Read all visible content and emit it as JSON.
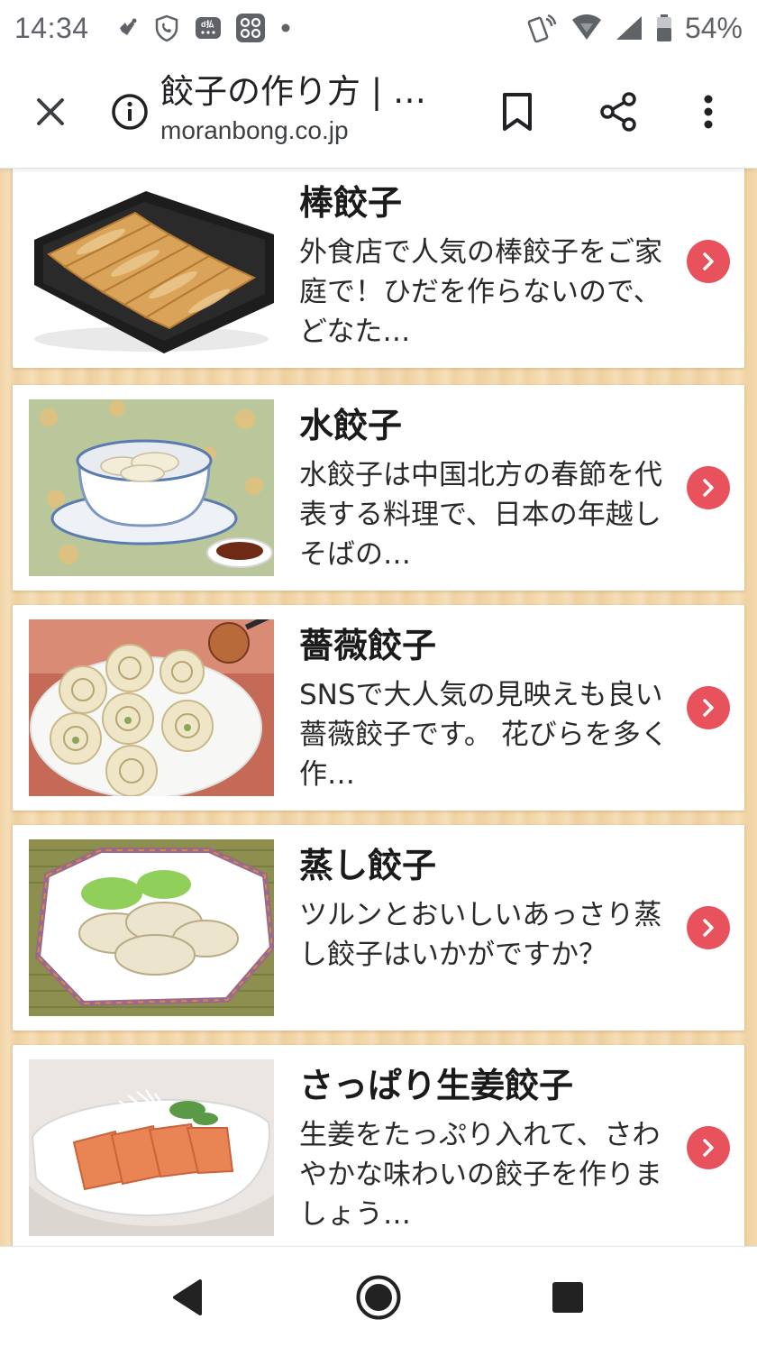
{
  "status_bar": {
    "time": "14:34",
    "battery": "54%",
    "icons": [
      "sparkle-notification-icon",
      "shield-call-icon",
      "d-payment-icon",
      "app-grid-icon",
      "dot-icon",
      "nfc-phone-icon",
      "wifi-icon",
      "signal-icon",
      "battery-icon"
    ]
  },
  "browser": {
    "title": "餃子の作り方 | …",
    "url": "moranbong.co.jp",
    "icons": [
      "close-icon",
      "info-icon",
      "bookmark-icon",
      "share-icon",
      "more-vert-icon"
    ]
  },
  "cards": [
    {
      "title": "棒餃子",
      "description": "外食店で人気の棒餃子をご家庭で！ひだを作らないので、どなた…"
    },
    {
      "title": "水餃子",
      "description": "水餃子は中国北方の春節を代表する料理で、日本の年越しそばの…"
    },
    {
      "title": "薔薇餃子",
      "description": "SNSで大人気の見映えも良い薔薇餃子です。 花びらを多く作…"
    },
    {
      "title": "蒸し餃子",
      "description": "ツルンとおいしいあっさり蒸し餃子はいかがですか？"
    },
    {
      "title": "さっぱり生姜餃子",
      "description": "生姜をたっぷり入れて、さわやかな味わいの餃子を作りましょう…"
    }
  ],
  "colors": {
    "accent_arrow": "#e8525c",
    "wood_background": "#f4d9ab"
  },
  "nav_bar": {
    "icons": [
      "back-triangle-icon",
      "home-circle-icon",
      "recents-square-icon"
    ]
  }
}
